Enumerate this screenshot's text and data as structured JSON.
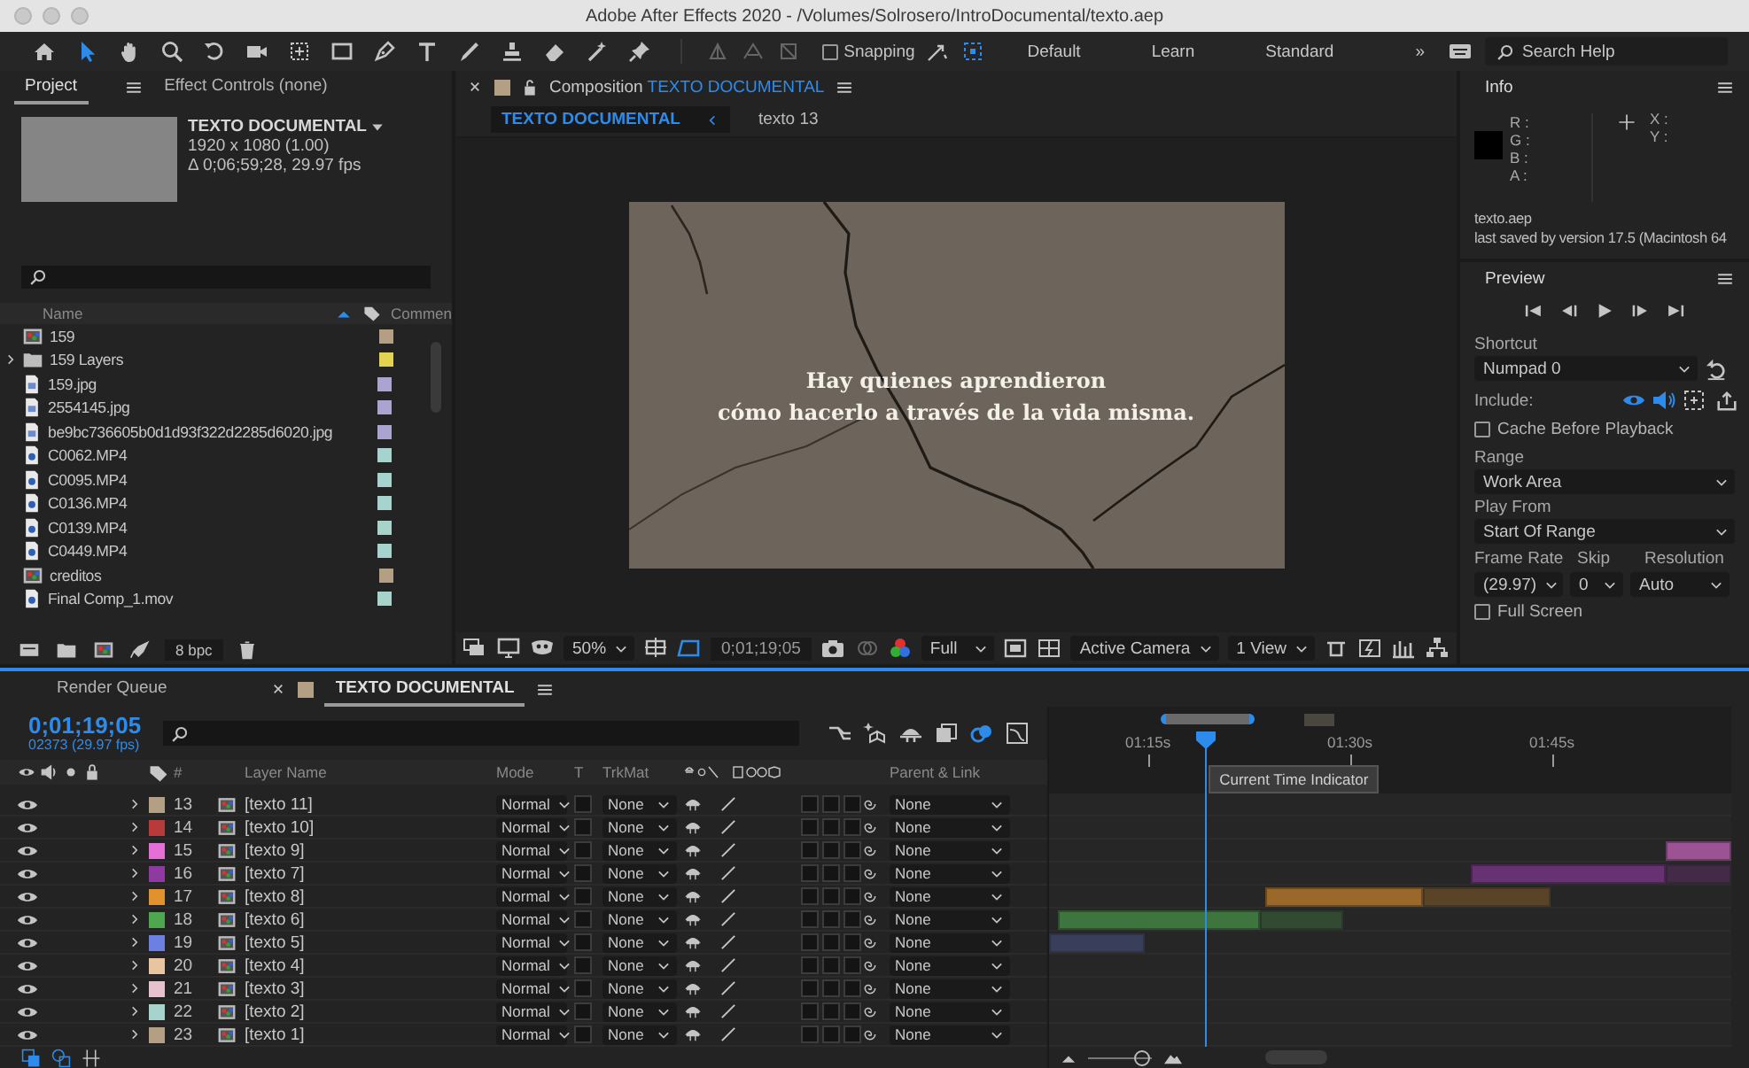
{
  "window": {
    "title": "Adobe After Effects 2020 - /Volumes/Solrosero/IntroDocumental/texto.aep"
  },
  "toolbar": {
    "tools": [
      {
        "kind": "home",
        "selected": false
      },
      {
        "kind": "selection",
        "selected": true
      },
      {
        "kind": "hand",
        "selected": false
      },
      {
        "kind": "zoom",
        "selected": false
      },
      {
        "kind": "rotation",
        "selected": false
      },
      {
        "kind": "camera",
        "selected": false
      },
      {
        "kind": "pan-behind",
        "selected": false
      },
      {
        "kind": "rectangle",
        "selected": false
      },
      {
        "kind": "pen",
        "selected": false
      },
      {
        "kind": "type",
        "selected": false
      },
      {
        "kind": "brush",
        "selected": false
      },
      {
        "kind": "stamp",
        "selected": false
      },
      {
        "kind": "eraser",
        "selected": false
      },
      {
        "kind": "roto",
        "selected": false
      },
      {
        "kind": "puppet",
        "selected": false
      }
    ],
    "snapping": {
      "label": "Snapping",
      "checked": false
    },
    "workspaces": [
      {
        "label": "Default",
        "selected": false
      },
      {
        "label": "Learn",
        "selected": false
      },
      {
        "label": "Standard",
        "selected": false
      }
    ],
    "overflow": "»",
    "search": {
      "placeholder": "Search Help"
    }
  },
  "project_panel": {
    "tabs": [
      {
        "label": "Project",
        "selected": true
      },
      {
        "label": "Effect Controls (none)",
        "selected": false
      }
    ],
    "preview": {
      "name": "TEXTO DOCUMENTAL",
      "size": "1920 x 1080 (1.00)",
      "duration": "Δ 0;06;59;28, 29.97 fps"
    },
    "columns": [
      "Name",
      "Commen"
    ],
    "items": [
      {
        "name": "159",
        "kind": "comp",
        "color": "#b39f84"
      },
      {
        "name": "159 Layers",
        "kind": "folder",
        "color": "#e2d44e"
      },
      {
        "name": "159.jpg",
        "kind": "image",
        "color": "#a9a5d0"
      },
      {
        "name": "2554145.jpg",
        "kind": "image",
        "color": "#a9a5d0"
      },
      {
        "name": "be9bc736605b0d1d93f322d2285d6020.jpg",
        "kind": "image",
        "color": "#a9a5d0"
      },
      {
        "name": "C0062.MP4",
        "kind": "video",
        "color": "#a6d4cc"
      },
      {
        "name": "C0095.MP4",
        "kind": "video",
        "color": "#a6d4cc"
      },
      {
        "name": "C0136.MP4",
        "kind": "video",
        "color": "#a6d4cc"
      },
      {
        "name": "C0139.MP4",
        "kind": "video",
        "color": "#a6d4cc"
      },
      {
        "name": "C0449.MP4",
        "kind": "video",
        "color": "#a6d4cc"
      },
      {
        "name": "creditos",
        "kind": "comp",
        "color": "#b39f84"
      },
      {
        "name": "Final Comp_1.mov",
        "kind": "video",
        "color": "#a6d4cc"
      }
    ],
    "bit_depth": "8 bpc"
  },
  "composition_panel": {
    "title_prefix": "Composition",
    "title": "TEXTO DOCUMENTAL",
    "breadcrumbs": [
      {
        "label": "TEXTO DOCUMENTAL",
        "selected": true
      },
      {
        "label": "texto 13",
        "selected": false
      }
    ],
    "caption": [
      "Hay quienes aprendieron",
      "cómo hacerlo a través de la vida misma."
    ],
    "footer": {
      "zoom": "50%",
      "timecode": "0;01;19;05",
      "resolution": "Full",
      "camera": "Active Camera",
      "views": "1 View"
    }
  },
  "info_panel": {
    "title": "Info",
    "channels": [
      "R :",
      "G :",
      "B :",
      "A :"
    ],
    "coords": [
      "X :",
      "Y :"
    ],
    "file": "texto.aep",
    "saved": "last saved by version 17.5 (Macintosh 64"
  },
  "preview_panel": {
    "title": "Preview",
    "shortcut_label": "Shortcut",
    "shortcut": "Numpad 0",
    "include_label": "Include:",
    "include": [
      {
        "kind": "video",
        "on": true
      },
      {
        "kind": "audio",
        "on": true
      },
      {
        "kind": "overlays",
        "on": false
      }
    ],
    "cache": {
      "label": "Cache Before Playback",
      "checked": false
    },
    "range_label": "Range",
    "range": "Work Area",
    "play_from_label": "Play From",
    "play_from": "Start Of Range",
    "frame_rate_label": "Frame Rate",
    "skip_label": "Skip",
    "resolution_label": "Resolution",
    "frame_rate": "(29.97)",
    "skip": "0",
    "resolution": "Auto",
    "full_screen": {
      "label": "Full Screen",
      "checked": false
    }
  },
  "timeline": {
    "tabs": [
      {
        "label": "Render Queue",
        "selected": false
      },
      {
        "label": "TEXTO DOCUMENTAL",
        "selected": true
      }
    ],
    "timecode": "0;01;19;05",
    "frame_info": "02373 (29.97 fps)",
    "columns": {
      "number": "#",
      "name": "Layer Name",
      "mode": "Mode",
      "t": "T",
      "trkmat": "TrkMat",
      "parent": "Parent & Link"
    },
    "ruler": [
      "01:15s",
      "01:30s",
      "01:45s"
    ],
    "playhead": {
      "level": 0.229
    },
    "tooltip": "Current Time Indicator",
    "zoom_slider": {
      "level": 0.85
    },
    "layers": [
      {
        "number": "13",
        "name": "[texto 11]",
        "color": "#b39f84",
        "visible": true,
        "mode": "Normal",
        "trkmat": "None",
        "parent": "None"
      },
      {
        "number": "14",
        "name": "[texto 10]",
        "color": "#b83a3a",
        "visible": true,
        "mode": "Normal",
        "trkmat": "None",
        "parent": "None"
      },
      {
        "number": "15",
        "name": "[texto 9]",
        "color": "#e46fd6",
        "visible": true,
        "mode": "Normal",
        "trkmat": "None",
        "parent": "None"
      },
      {
        "number": "16",
        "name": "[texto 7]",
        "color": "#8f3aa0",
        "visible": true,
        "mode": "Normal",
        "trkmat": "None",
        "parent": "None"
      },
      {
        "number": "17",
        "name": "[texto 8]",
        "color": "#e2922c",
        "visible": true,
        "mode": "Normal",
        "trkmat": "None",
        "parent": "None"
      },
      {
        "number": "18",
        "name": "[texto 6]",
        "color": "#4ea64e",
        "visible": true,
        "mode": "Normal",
        "trkmat": "None",
        "parent": "None"
      },
      {
        "number": "19",
        "name": "[texto 5]",
        "color": "#6b80e0",
        "visible": true,
        "mode": "Normal",
        "trkmat": "None",
        "parent": "None"
      },
      {
        "number": "20",
        "name": "[texto 4]",
        "color": "#e8c4a0",
        "visible": true,
        "mode": "Normal",
        "trkmat": "None",
        "parent": "None"
      },
      {
        "number": "21",
        "name": "[texto 3]",
        "color": "#e6c2cf",
        "visible": true,
        "mode": "Normal",
        "trkmat": "None",
        "parent": "None"
      },
      {
        "number": "22",
        "name": "[texto 2]",
        "color": "#a6d4cc",
        "visible": true,
        "mode": "Normal",
        "trkmat": "None",
        "parent": "None"
      },
      {
        "number": "23",
        "name": "[texto 1]",
        "color": "#b39f84",
        "visible": true,
        "mode": "Normal",
        "trkmat": "None",
        "parent": "None"
      }
    ]
  }
}
